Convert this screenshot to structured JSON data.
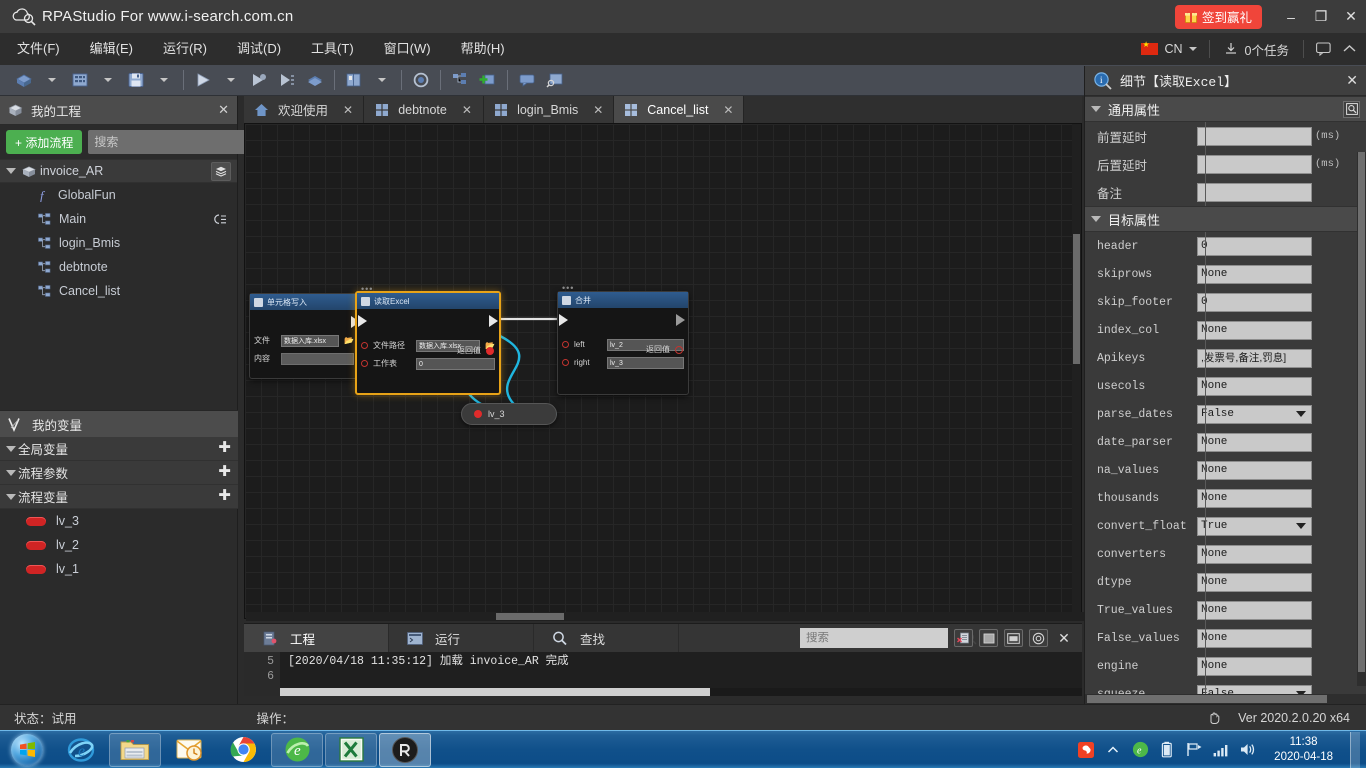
{
  "titlebar": {
    "app_title": "RPAStudio For www.i-search.com.cn",
    "signin_label": "签到赢礼",
    "minimize": "–",
    "maximize": "❐",
    "close": "✕"
  },
  "menubar": {
    "items": [
      {
        "label": "文件(F)"
      },
      {
        "label": "编辑(E)"
      },
      {
        "label": "运行(R)"
      },
      {
        "label": "调试(D)"
      },
      {
        "label": "工具(T)"
      },
      {
        "label": "窗口(W)"
      },
      {
        "label": "帮助(H)"
      }
    ],
    "language": "CN",
    "tasks_label": "0个任务"
  },
  "project_panel": {
    "title": "我的工程",
    "close": "✕",
    "add_flow_label": "+ 添加流程",
    "search_placeholder": "搜索",
    "search_value": "",
    "root": "invoice_AR",
    "items": [
      {
        "label": "GlobalFun",
        "icon": "function-icon"
      },
      {
        "label": "Main",
        "icon": "flow-icon"
      },
      {
        "label": "login_Bmis",
        "icon": "flow-icon"
      },
      {
        "label": "debtnote",
        "icon": "flow-icon"
      },
      {
        "label": "Cancel_list",
        "icon": "flow-icon"
      }
    ]
  },
  "variables_panel": {
    "title": "我的变量",
    "groups": [
      {
        "label": "全局变量",
        "items": []
      },
      {
        "label": "流程参数",
        "items": []
      },
      {
        "label": "流程变量",
        "items": [
          {
            "label": "lv_3"
          },
          {
            "label": "lv_2"
          },
          {
            "label": "lv_1"
          }
        ]
      }
    ]
  },
  "tabs": [
    {
      "label": "欢迎使用",
      "icon": "home-icon",
      "active": false
    },
    {
      "label": "debtnote",
      "icon": "flow-icon",
      "active": false
    },
    {
      "label": "login_Bmis",
      "icon": "flow-icon",
      "active": false
    },
    {
      "label": "Cancel_list",
      "icon": "flow-icon",
      "active": true
    }
  ],
  "canvas": {
    "nodes": [
      {
        "title": "单元格写入",
        "selected": false,
        "fields": [
          {
            "label": "文件",
            "value": "数据入库.xlsx",
            "has_pin": false
          },
          {
            "label": "内容",
            "value": "",
            "has_pin": false
          }
        ],
        "return_label": ""
      },
      {
        "title": "读取Excel",
        "selected": true,
        "return_label": "返回值",
        "fields": [
          {
            "label": "文件路径",
            "value": "数据入库.xlsx",
            "has_pin": true
          },
          {
            "label": "工作表",
            "value": "0",
            "has_pin": true
          }
        ]
      },
      {
        "title": "合并",
        "selected": false,
        "return_label": "返回值",
        "fields": [
          {
            "label": "left",
            "value": "lv_2",
            "has_pin": true
          },
          {
            "label": "right",
            "value": "lv_3",
            "has_pin": true
          }
        ]
      }
    ],
    "variable_node": {
      "label": "lv_3"
    }
  },
  "output_panel": {
    "tabs": [
      {
        "label": "工程",
        "icon": "project-icon",
        "active": true
      },
      {
        "label": "运行",
        "icon": "run-icon",
        "active": false
      },
      {
        "label": "查找",
        "icon": "search-icon",
        "active": false
      }
    ],
    "search_placeholder": "搜索",
    "search_value": "",
    "close": "✕",
    "log_lines": [
      {
        "num": "5",
        "text": "[2020/04/18 11:35:12] 加载 invoice_AR 完成"
      },
      {
        "num": "6",
        "text": ""
      }
    ]
  },
  "properties_panel": {
    "title": "细节【读取Excel】",
    "close": "✕",
    "sections": [
      {
        "label": "通用属性",
        "props": [
          {
            "name": "前置延时",
            "value": "",
            "unit": "(ms)",
            "type": "text",
            "cjk": true
          },
          {
            "name": "后置延时",
            "value": "",
            "unit": "(ms)",
            "type": "text",
            "cjk": true
          },
          {
            "name": "备注",
            "value": "",
            "unit": "",
            "type": "text",
            "cjk": true
          }
        ]
      },
      {
        "label": "目标属性",
        "props": [
          {
            "name": "header",
            "value": "0",
            "unit": "",
            "type": "text",
            "cjk": false
          },
          {
            "name": "skiprows",
            "value": "None",
            "unit": "",
            "type": "text",
            "cjk": false
          },
          {
            "name": "skip_footer",
            "value": "0",
            "unit": "",
            "type": "text",
            "cjk": false
          },
          {
            "name": "index_col",
            "value": "None",
            "unit": "",
            "type": "text",
            "cjk": false
          },
          {
            "name": "Apikeys",
            "value": ",发票号,备注,罚息]",
            "unit": "",
            "type": "text",
            "cjk": true
          },
          {
            "name": "usecols",
            "value": "None",
            "unit": "",
            "type": "text",
            "cjk": false
          },
          {
            "name": "parse_dates",
            "value": "False",
            "unit": "",
            "type": "select",
            "cjk": false
          },
          {
            "name": "date_parser",
            "value": "None",
            "unit": "",
            "type": "text",
            "cjk": false
          },
          {
            "name": "na_values",
            "value": "None",
            "unit": "",
            "type": "text",
            "cjk": false
          },
          {
            "name": "thousands",
            "value": "None",
            "unit": "",
            "type": "text",
            "cjk": false
          },
          {
            "name": "convert_float",
            "value": "True",
            "unit": "",
            "type": "select",
            "cjk": false
          },
          {
            "name": "converters",
            "value": "None",
            "unit": "",
            "type": "text",
            "cjk": false
          },
          {
            "name": "dtype",
            "value": "None",
            "unit": "",
            "type": "text",
            "cjk": false
          },
          {
            "name": "True_values",
            "value": "None",
            "unit": "",
            "type": "text",
            "cjk": false
          },
          {
            "name": "False_values",
            "value": "None",
            "unit": "",
            "type": "text",
            "cjk": false
          },
          {
            "name": "engine",
            "value": "None",
            "unit": "",
            "type": "text",
            "cjk": false
          },
          {
            "name": "squeeze",
            "value": "False",
            "unit": "",
            "type": "select",
            "cjk": false
          }
        ]
      }
    ]
  },
  "statusbar": {
    "state_label": "状态：试用",
    "operation_label": "操作：",
    "version": "Ver 2020.2.0.20 x64"
  },
  "taskbar": {
    "apps": [
      {
        "name": "internet-explorer",
        "pinned": false
      },
      {
        "name": "file-explorer",
        "pinned": true
      },
      {
        "name": "outlook",
        "pinned": false
      },
      {
        "name": "chrome",
        "pinned": false
      },
      {
        "name": "edge-360",
        "pinned": true
      },
      {
        "name": "excel",
        "pinned": true
      },
      {
        "name": "rpastudio",
        "pinned": true
      }
    ],
    "clock_time": "11:38",
    "clock_date": "2020-04-18"
  },
  "colors": {
    "accent_red": "#f0453a",
    "accent_green": "#4caf50",
    "node_selected": "#e8a317",
    "wire_blue": "#1fb6e0",
    "titlebar_bg": "#3c3c3c",
    "panel_bg": "#2b2b2b"
  }
}
